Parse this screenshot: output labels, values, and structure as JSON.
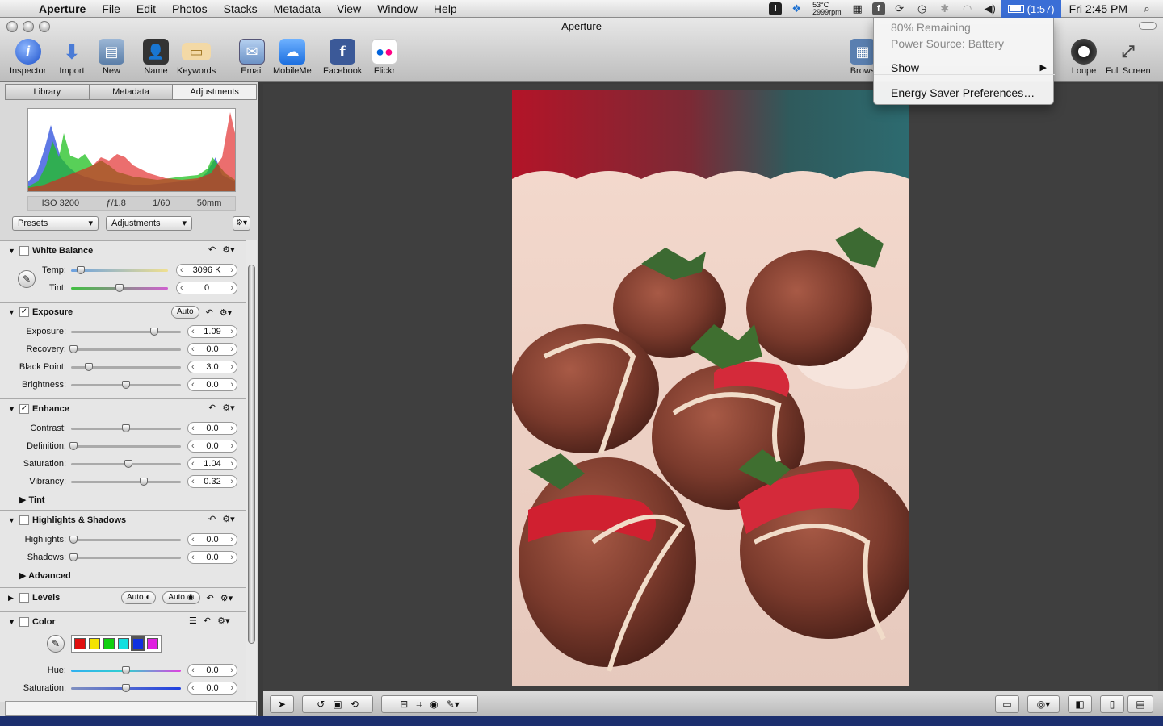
{
  "menubar": {
    "app_name": "Aperture",
    "menus": [
      "File",
      "Edit",
      "Photos",
      "Stacks",
      "Metadata",
      "View",
      "Window",
      "Help"
    ],
    "temp": "53°C",
    "fan": "2999rpm",
    "battery_time": "(1:57)",
    "clock": "Fri 2:45 PM"
  },
  "window": {
    "title": "Aperture"
  },
  "toolbar": {
    "inspector": "Inspector",
    "import": "Import",
    "new": "New",
    "name": "Name",
    "keywords": "Keywords",
    "email": "Email",
    "mobileme": "MobileMe",
    "facebook": "Facebook",
    "flickr": "Flickr",
    "browser": "Brows",
    "loupe": "Loupe",
    "fullscreen": "Full Screen"
  },
  "tabs": [
    "Library",
    "Metadata",
    "Adjustments"
  ],
  "exif": {
    "iso": "ISO 3200",
    "aperture": "ƒ/1.8",
    "shutter": "1/60",
    "focal": "50mm"
  },
  "presets": {
    "presets_label": "Presets",
    "adjustments_label": "Adjustments"
  },
  "white_balance": {
    "title": "White Balance",
    "temp_label": "Temp:",
    "temp_value": "3096 K",
    "tint_label": "Tint:",
    "tint_value": "0"
  },
  "exposure": {
    "title": "Exposure",
    "auto": "Auto",
    "rows": [
      {
        "label": "Exposure:",
        "value": "1.09"
      },
      {
        "label": "Recovery:",
        "value": "0.0"
      },
      {
        "label": "Black Point:",
        "value": "3.0"
      },
      {
        "label": "Brightness:",
        "value": "0.0"
      }
    ]
  },
  "enhance": {
    "title": "Enhance",
    "rows": [
      {
        "label": "Contrast:",
        "value": "0.0"
      },
      {
        "label": "Definition:",
        "value": "0.0"
      },
      {
        "label": "Saturation:",
        "value": "1.04"
      },
      {
        "label": "Vibrancy:",
        "value": "0.32"
      }
    ],
    "tint": "Tint"
  },
  "highlights": {
    "title": "Highlights & Shadows",
    "rows": [
      {
        "label": "Highlights:",
        "value": "0.0"
      },
      {
        "label": "Shadows:",
        "value": "0.0"
      }
    ],
    "advanced": "Advanced"
  },
  "levels": {
    "title": "Levels",
    "auto1": "Auto",
    "auto2": "Auto"
  },
  "color": {
    "title": "Color",
    "swatches": [
      "#e01010",
      "#f5e400",
      "#10d010",
      "#10e0e0",
      "#1030e0",
      "#e020e0"
    ],
    "rows": [
      {
        "label": "Hue:",
        "value": "0.0"
      },
      {
        "label": "Saturation:",
        "value": "0.0"
      }
    ]
  },
  "battery_menu": {
    "remaining": "80% Remaining",
    "source": "Power Source: Battery",
    "show": "Show",
    "energy": "Energy Saver Preferences…"
  }
}
